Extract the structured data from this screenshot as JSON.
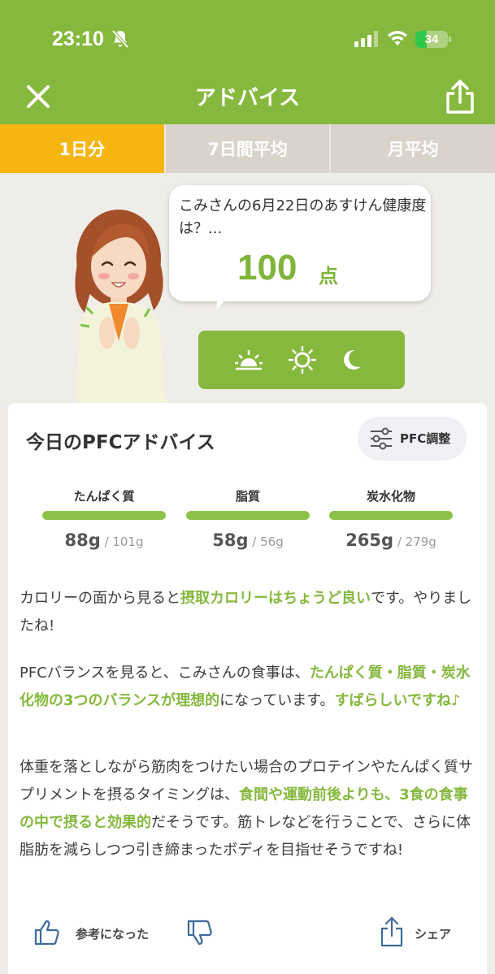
{
  "status_bar": {
    "time": "23:10",
    "battery": "34",
    "battery_level": 0.34
  },
  "nav": {
    "title": "アドバイス"
  },
  "tabs": [
    {
      "label": "1日分",
      "active": true
    },
    {
      "label": "7日間平均",
      "active": false
    },
    {
      "label": "月平均",
      "active": false
    }
  ],
  "summary": {
    "bubble_text": "こみさんの6月22日のあすけん健康度は？...",
    "score": "100",
    "score_unit": "点"
  },
  "time_of_day": [
    "sunrise-icon",
    "sun-icon",
    "moon-icon"
  ],
  "card": {
    "title": "今日のPFCアドバイス",
    "adjust_label": "PFC調整"
  },
  "nutrients": [
    {
      "label": "たんぱく質",
      "value": "88g",
      "target": " / 101g",
      "fill": 1.0
    },
    {
      "label": "脂質",
      "value": "58g",
      "target": " / 56g",
      "fill": 1.0
    },
    {
      "label": "炭水化物",
      "value": "265g",
      "target": " / 279g",
      "fill": 1.0
    }
  ],
  "advice": {
    "p1": {
      "a": "カロリーの面から見ると",
      "b": "摂取カロリーはちょうど良い",
      "c": "です。やりましたね!"
    },
    "p2": {
      "a": "PFCバランスを見ると、こみさんの食事は、",
      "b": "たんぱく質・脂質・炭水化物の3つのバランスが理想的",
      "c": "になっています。",
      "d": "すばらしいですね♪"
    },
    "p3": {
      "a": "体重を落としながら筋肉をつけたい場合のプロテインやたんぱく質サプリメントを摂るタイミングは、",
      "b": "食間や運動前後よりも、3食の食事の中で摂ると効果的",
      "c": "だそうです。筋トレなどを行うことで、さらに体脂肪を減らしつつ引き締まったボディを目指せそうですね!"
    }
  },
  "footer": {
    "helpful": "参考になった",
    "share": "シェア"
  },
  "colors": {
    "brand_green": "#86b83e",
    "tab_active": "#f7b512",
    "tab_inactive": "#d9d3cc",
    "highlight_text": "#86b83e"
  }
}
